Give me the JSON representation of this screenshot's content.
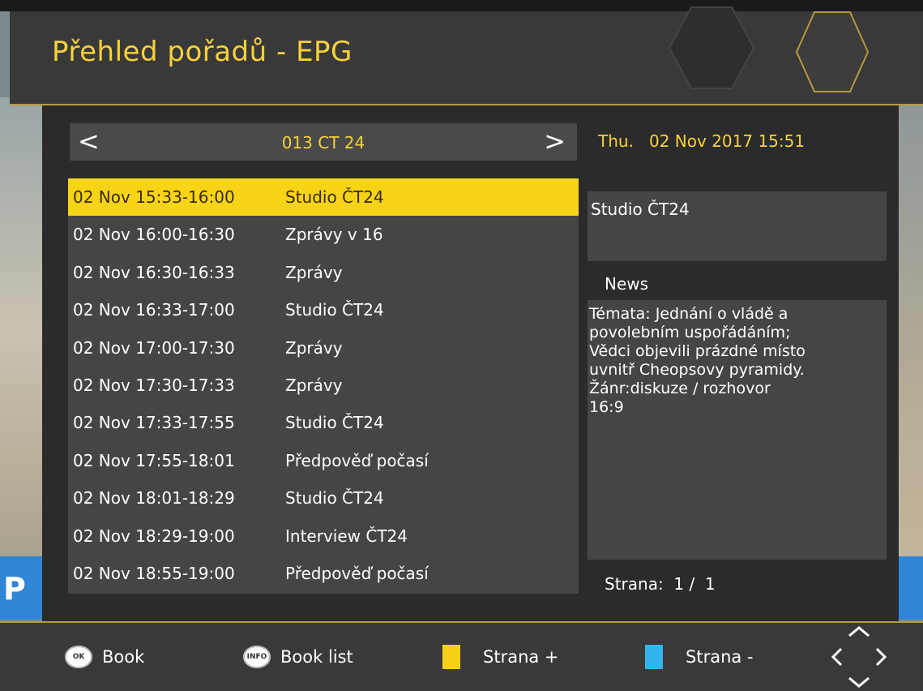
{
  "header": {
    "title": "Přehled pořadů - EPG"
  },
  "channel": {
    "prev_symbol": "<",
    "name": "013 CT 24",
    "next_symbol": ">"
  },
  "datetime": "Thu.   02 Nov 2017 15:51",
  "programs": [
    {
      "time": "02 Nov 15:33-16:00",
      "title": "Studio ČT24",
      "selected": true
    },
    {
      "time": "02 Nov 16:00-16:30",
      "title": "Zprávy v 16"
    },
    {
      "time": "02 Nov 16:30-16:33",
      "title": "Zprávy"
    },
    {
      "time": "02 Nov 16:33-17:00",
      "title": "Studio ČT24"
    },
    {
      "time": "02 Nov 17:00-17:30",
      "title": "Zprávy"
    },
    {
      "time": "02 Nov 17:30-17:33",
      "title": "Zprávy"
    },
    {
      "time": "02 Nov 17:33-17:55",
      "title": "Studio ČT24"
    },
    {
      "time": "02 Nov 17:55-18:01",
      "title": "Předpověď počasí"
    },
    {
      "time": "02 Nov 18:01-18:29",
      "title": "Studio ČT24"
    },
    {
      "time": "02 Nov 18:29-19:00",
      "title": "Interview ČT24"
    },
    {
      "time": "02 Nov 18:55-19:00",
      "title": "Předpověď počasí"
    }
  ],
  "info": {
    "title": "Studio ČT24",
    "genre": "News",
    "description": "Témata: Jednání o vládě a\npovolebním uspořádáním;\nVědci objevili prázdné místo\nuvnitř Cheopsovy pyramidy.\nŽánr:diskuze / rozhovor\n16:9",
    "page": "Strana:  1 /  1"
  },
  "footer": {
    "ok_icon_text": "OK",
    "book_label": "Book",
    "info_icon_text": "INFO",
    "book_list_label": "Book list",
    "page_plus_label": "Strana +",
    "page_minus_label": "Strana -"
  },
  "background_overlay_letter": "P",
  "colors": {
    "accent": "#f6d23a",
    "selected": "#f8d418",
    "blue_key": "#34b4ee",
    "yellow_key": "#f6d018"
  }
}
